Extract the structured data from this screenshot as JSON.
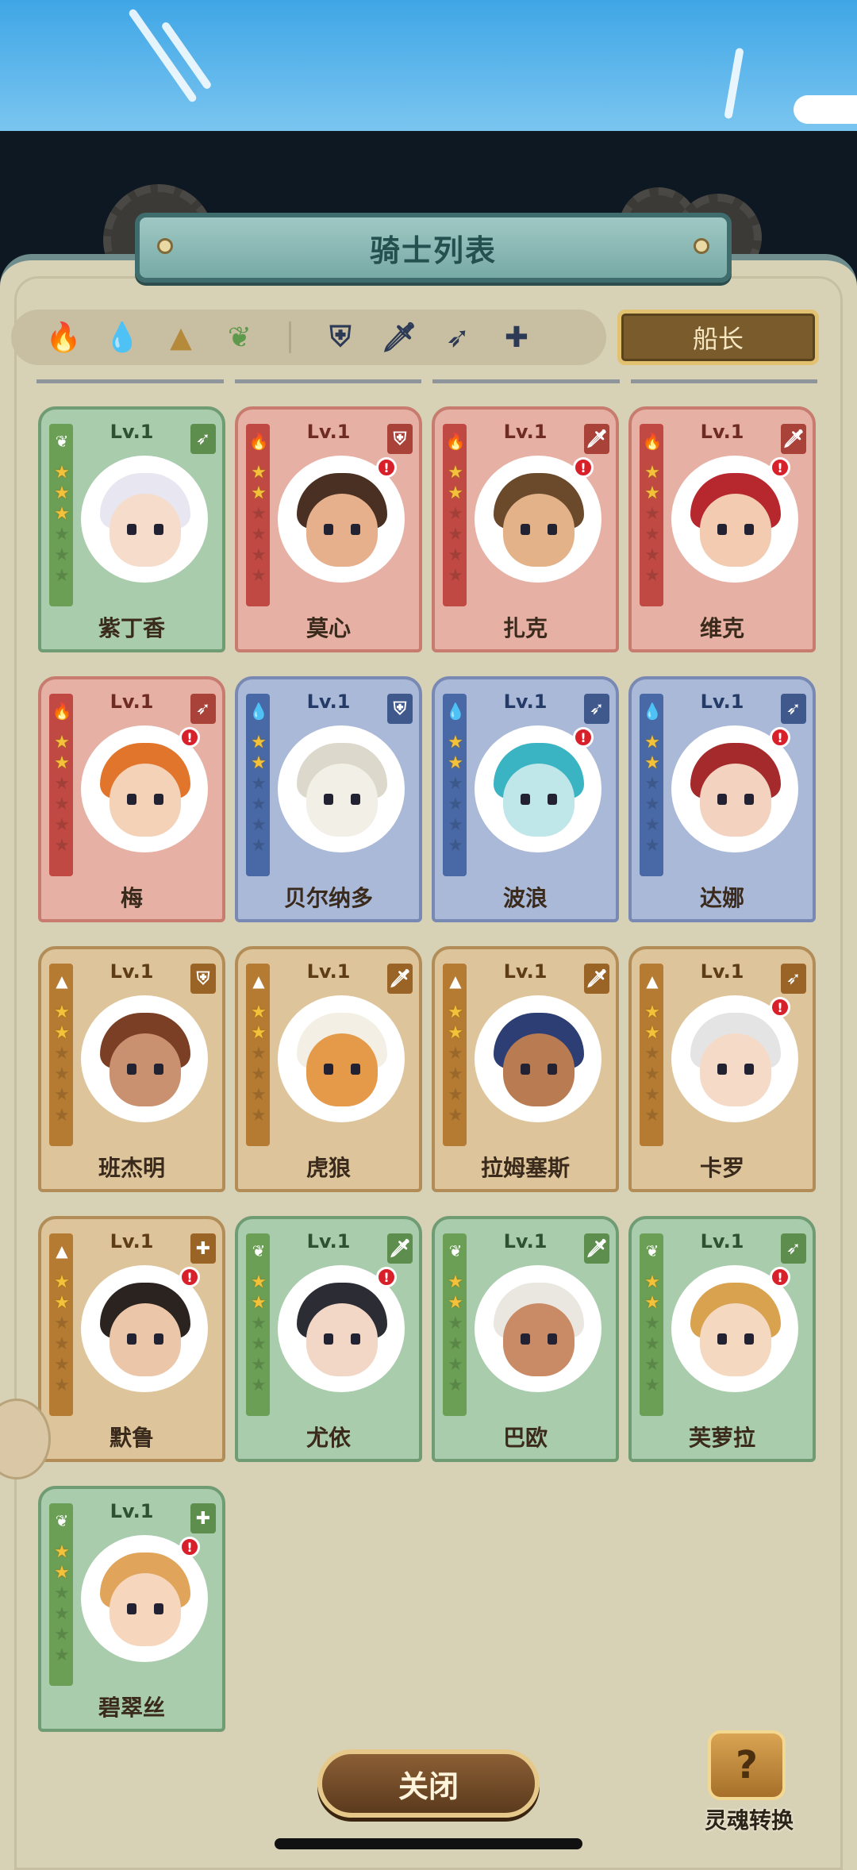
{
  "title": "骑士列表",
  "filters": {
    "elements": [
      {
        "icon": "fire-element-icon",
        "glyph": "🔥",
        "color": "#c0453b"
      },
      {
        "icon": "water-element-icon",
        "glyph": "💧",
        "color": "#3f67b8"
      },
      {
        "icon": "earth-element-icon",
        "glyph": "▲",
        "color": "#b58a3a"
      },
      {
        "icon": "wind-element-icon",
        "glyph": "❦",
        "color": "#5f9a4c"
      }
    ],
    "classes": [
      {
        "icon": "shield-class-icon",
        "glyph": "⛨"
      },
      {
        "icon": "sword-class-icon",
        "glyph": "🗡"
      },
      {
        "icon": "bow-class-icon",
        "glyph": "➶"
      },
      {
        "icon": "cross-class-icon",
        "glyph": "✚"
      }
    ],
    "captain_label": "船长"
  },
  "knights": [
    {
      "name": "紫丁香",
      "level": "Lv.1",
      "element": "green",
      "element_glyph": "❦",
      "class_glyph": "➶",
      "stars": 3,
      "alert": false,
      "skin": "#f6dccb",
      "hair": "#e8e6f0"
    },
    {
      "name": "莫心",
      "level": "Lv.1",
      "element": "red",
      "element_glyph": "🔥",
      "class_glyph": "⛨",
      "stars": 2,
      "alert": true,
      "skin": "#e7b08c",
      "hair": "#4a3022"
    },
    {
      "name": "扎克",
      "level": "Lv.1",
      "element": "red",
      "element_glyph": "🔥",
      "class_glyph": "🗡",
      "stars": 2,
      "alert": true,
      "skin": "#e4b288",
      "hair": "#6b4a2c"
    },
    {
      "name": "维克",
      "level": "Lv.1",
      "element": "red",
      "element_glyph": "🔥",
      "class_glyph": "🗡",
      "stars": 2,
      "alert": true,
      "skin": "#f2cbb0",
      "hair": "#b7282e"
    },
    {
      "name": "梅",
      "level": "Lv.1",
      "element": "red",
      "element_glyph": "🔥",
      "class_glyph": "➶",
      "stars": 2,
      "alert": true,
      "skin": "#f4d2b8",
      "hair": "#e2752c"
    },
    {
      "name": "贝尔纳多",
      "level": "Lv.1",
      "element": "blue",
      "element_glyph": "💧",
      "class_glyph": "⛨",
      "stars": 2,
      "alert": false,
      "skin": "#f2efe6",
      "hair": "#dcd8cc"
    },
    {
      "name": "波浪",
      "level": "Lv.1",
      "element": "blue",
      "element_glyph": "💧",
      "class_glyph": "➶",
      "stars": 2,
      "alert": true,
      "skin": "#bfe7ea",
      "hair": "#3ab4c3"
    },
    {
      "name": "达娜",
      "level": "Lv.1",
      "element": "blue",
      "element_glyph": "💧",
      "class_glyph": "➶",
      "stars": 2,
      "alert": true,
      "skin": "#f3d3c0",
      "hair": "#a42a2c"
    },
    {
      "name": "班杰明",
      "level": "Lv.1",
      "element": "brown",
      "element_glyph": "▲",
      "class_glyph": "⛨",
      "stars": 2,
      "alert": false,
      "skin": "#c99170",
      "hair": "#7a3f25"
    },
    {
      "name": "虎狼",
      "level": "Lv.1",
      "element": "brown",
      "element_glyph": "▲",
      "class_glyph": "🗡",
      "stars": 2,
      "alert": false,
      "skin": "#e59a4a",
      "hair": "#f3efe5"
    },
    {
      "name": "拉姆塞斯",
      "level": "Lv.1",
      "element": "brown",
      "element_glyph": "▲",
      "class_glyph": "🗡",
      "stars": 2,
      "alert": false,
      "skin": "#b97b52",
      "hair": "#2c3e74"
    },
    {
      "name": "卡罗",
      "level": "Lv.1",
      "element": "brown",
      "element_glyph": "▲",
      "class_glyph": "➶",
      "stars": 2,
      "alert": true,
      "skin": "#f5dac8",
      "hair": "#e4e4e4"
    },
    {
      "name": "默鲁",
      "level": "Lv.1",
      "element": "brown",
      "element_glyph": "▲",
      "class_glyph": "✚",
      "stars": 2,
      "alert": true,
      "skin": "#ecc6a8",
      "hair": "#2a2320"
    },
    {
      "name": "尤依",
      "level": "Lv.1",
      "element": "green",
      "element_glyph": "❦",
      "class_glyph": "🗡",
      "stars": 2,
      "alert": true,
      "skin": "#f3d7c6",
      "hair": "#2c2c34"
    },
    {
      "name": "巴欧",
      "level": "Lv.1",
      "element": "green",
      "element_glyph": "❦",
      "class_glyph": "🗡",
      "stars": 2,
      "alert": false,
      "skin": "#c98b66",
      "hair": "#eae6e0"
    },
    {
      "name": "芙萝拉",
      "level": "Lv.1",
      "element": "green",
      "element_glyph": "❦",
      "class_glyph": "➶",
      "stars": 2,
      "alert": true,
      "skin": "#f4d8c0",
      "hair": "#d8a24f"
    },
    {
      "name": "碧翠丝",
      "level": "Lv.1",
      "element": "green",
      "element_glyph": "❦",
      "class_glyph": "✚",
      "stars": 2,
      "alert": true,
      "skin": "#f6d7bd",
      "hair": "#e0a45a"
    }
  ],
  "buttons": {
    "close_label": "关闭",
    "soul_convert_label": "灵魂转换",
    "soul_icon_glyph": "?"
  }
}
